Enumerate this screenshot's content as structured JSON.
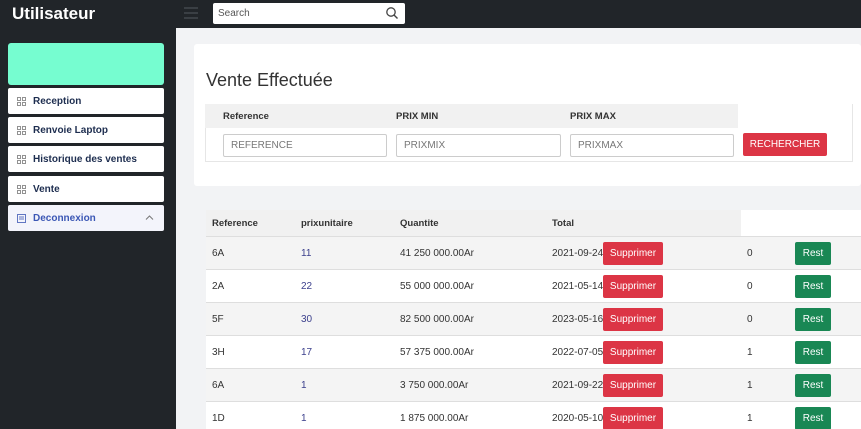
{
  "app": {
    "brand": "Utilisateur"
  },
  "search": {
    "placeholder": "Search"
  },
  "sidebar": {
    "items": [
      {
        "label": "Reception"
      },
      {
        "label": "Renvoie Laptop"
      },
      {
        "label": "Historique des ventes"
      },
      {
        "label": "Vente"
      },
      {
        "label": "Deconnexion"
      }
    ]
  },
  "page": {
    "title": "Vente Effectuée"
  },
  "filters": {
    "reference_label": "Reference",
    "prixmin_label": "PRIX MIN",
    "prixmax_label": "PRIX MAX",
    "reference_placeholder": "REFERENCE",
    "prixmin_placeholder": "PRIXMIX",
    "prixmax_placeholder": "PRIXMAX",
    "search_button": "RECHERCHER"
  },
  "table": {
    "headers": [
      "Reference",
      "prixunitaire",
      "Quantite",
      "Total"
    ],
    "delete_label": "Supprimer",
    "rest_label": "Rest",
    "rows": [
      {
        "reference": "6A",
        "prixunitaire": "11",
        "quantite": "41 250 000.00Ar",
        "total": "2021-09-24",
        "count": "0"
      },
      {
        "reference": "2A",
        "prixunitaire": "22",
        "quantite": "55 000 000.00Ar",
        "total": "2021-05-14",
        "count": "0"
      },
      {
        "reference": "5F",
        "prixunitaire": "30",
        "quantite": "82 500 000.00Ar",
        "total": "2023-05-16",
        "count": "0"
      },
      {
        "reference": "3H",
        "prixunitaire": "17",
        "quantite": "57 375 000.00Ar",
        "total": "2022-07-05",
        "count": "1"
      },
      {
        "reference": "6A",
        "prixunitaire": "1",
        "quantite": "3 750 000.00Ar",
        "total": "2021-09-22",
        "count": "1"
      },
      {
        "reference": "1D",
        "prixunitaire": "1",
        "quantite": "1 875 000.00Ar",
        "total": "2020-05-10",
        "count": "1"
      }
    ]
  },
  "colors": {
    "danger": "#dc3545",
    "success": "#198754",
    "sidebar_card": "#76fdd0",
    "dark": "#212529"
  },
  "icons": {
    "search": "search-icon",
    "menu": "menu-icon",
    "grid": "grid-icon",
    "logout": "logout-icon",
    "chevron": "chevron-up-icon"
  }
}
